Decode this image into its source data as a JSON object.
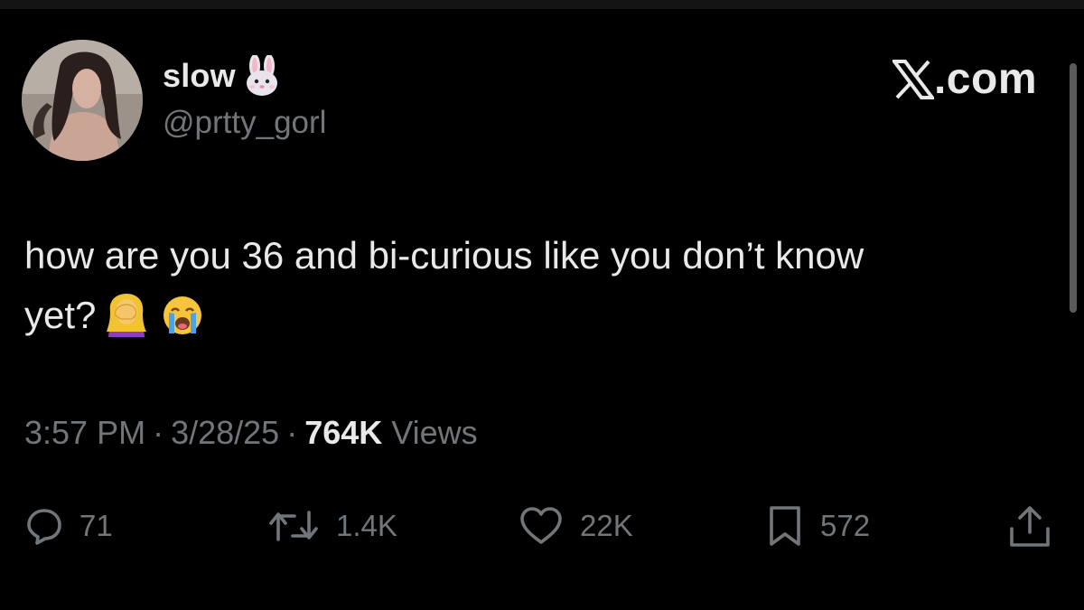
{
  "author": {
    "display_name": "slow",
    "name_emoji": "rabbit-face",
    "handle": "@prtty_gorl"
  },
  "brand": {
    "text": ".com",
    "icon": "x-logo"
  },
  "tweet": {
    "line1": "how are you 36 and bi-curious like you don’t know",
    "line2": "yet?",
    "emojis": [
      "woman-facepalming",
      "loudly-crying-face"
    ]
  },
  "meta": {
    "time": "3:57 PM",
    "separator": "·",
    "date": "3/28/25",
    "views_count": "764K",
    "views_label": "Views"
  },
  "actions": {
    "replies": "71",
    "reposts": "1.4K",
    "likes": "22K",
    "bookmarks": "572"
  },
  "colors": {
    "background": "#000000",
    "text_primary": "#e7e9ea",
    "text_secondary": "#71767b"
  }
}
